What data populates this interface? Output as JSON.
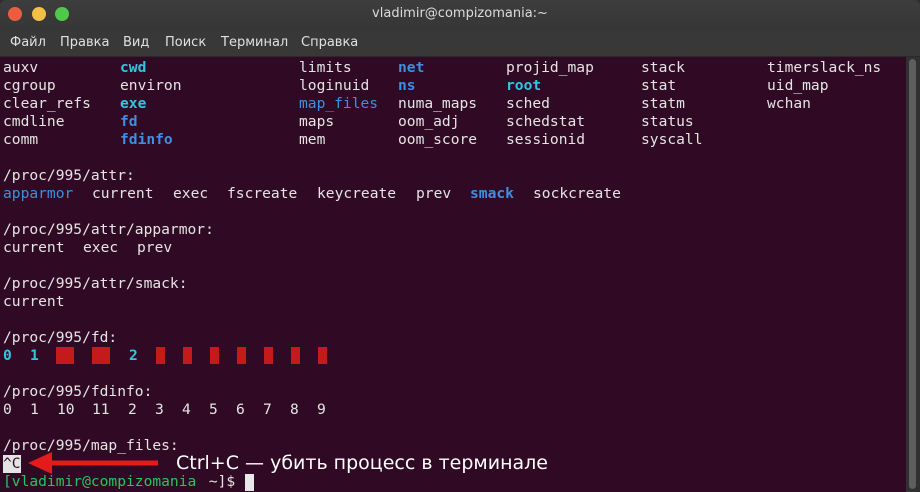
{
  "window": {
    "title": "vladimir@compizomania:~",
    "controls": {
      "close": "close-icon",
      "minimize": "minimize-icon",
      "maximize": "maximize-icon"
    }
  },
  "menu": [
    "Файл",
    "Правка",
    "Вид",
    "Поиск",
    "Терминал",
    "Справка"
  ],
  "terminal": {
    "colors": {
      "background": "#300a24",
      "dir": "#3f8ee0",
      "link": "#2fc6e4",
      "text": "#e4e4e4",
      "prompt": "#27c45c",
      "annotation_arrow": "#e31b1b",
      "fd_blocks": "#c41a1a"
    },
    "listing": {
      "col1": [
        "auxv",
        "cgroup",
        "clear_refs",
        "cmdline",
        "comm"
      ],
      "col2": [
        "cwd",
        "environ",
        "exe",
        "fd",
        "fdinfo"
      ],
      "col3": [
        "limits",
        "loginuid",
        "map_files",
        "maps",
        "mem"
      ],
      "col4": [
        "net",
        "ns",
        "numa_maps",
        "oom_adj",
        "oom_score"
      ],
      "col5": [
        "projid_map",
        "root",
        "sched",
        "schedstat",
        "sessionid"
      ],
      "col6": [
        "stack",
        "stat",
        "statm",
        "status",
        "syscall"
      ],
      "col7": [
        "timerslack_ns",
        "uid_map",
        "wchan"
      ]
    },
    "attr_header": "/proc/995/attr:",
    "attr_items": [
      "apparmor",
      "current",
      "exec",
      "fscreate",
      "keycreate",
      "prev",
      "smack",
      "sockcreate"
    ],
    "apparmor_header": "/proc/995/attr/apparmor:",
    "apparmor_items": [
      "current",
      "exec",
      "prev"
    ],
    "smack_header": "/proc/995/attr/smack:",
    "smack_items": [
      "current"
    ],
    "fd_header": "/proc/995/fd:",
    "fd_items": [
      "0",
      "1",
      "2"
    ],
    "fdinfo_header": "/proc/995/fdinfo:",
    "fdinfo_items": [
      "0",
      "1",
      "10",
      "11",
      "2",
      "3",
      "4",
      "5",
      "6",
      "7",
      "8",
      "9"
    ],
    "map_files_header": "/proc/995/map_files:",
    "interrupt": "^C",
    "prompt_user": "[vladimir@compizomania",
    "prompt_rest": " ~]$ "
  },
  "annotation": {
    "text": "Ctrl+C — убить процесс в терминале"
  }
}
